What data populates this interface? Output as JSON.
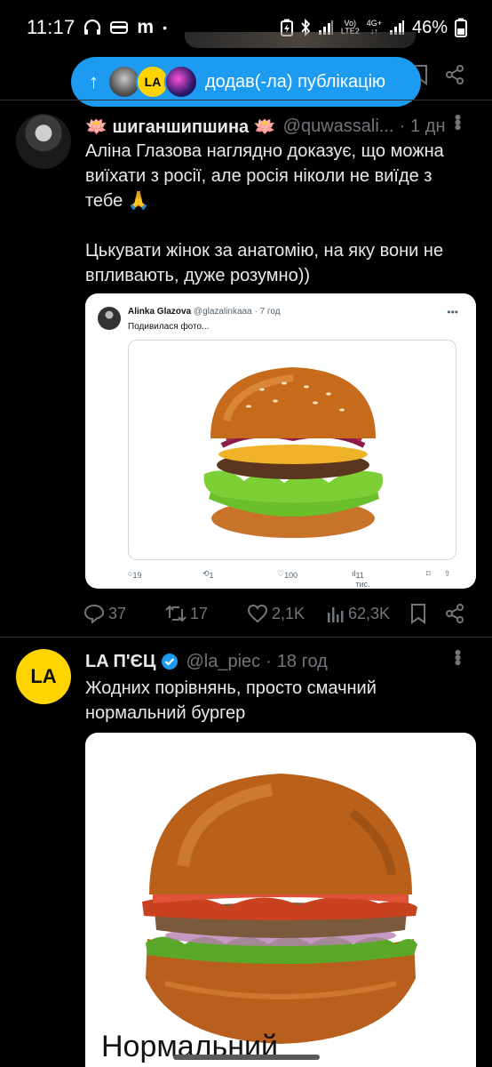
{
  "status_bar": {
    "time": "11:17",
    "carrier_glyph": "m",
    "dot": "•",
    "network_top": "Vo)",
    "network_bottom": "LTE2",
    "network_4g": "4G+",
    "battery": "46%"
  },
  "new_posts_pill": {
    "arrow": "↑",
    "avatar_la": "LA",
    "text": "додав(-ла) публікацію"
  },
  "tweet1": {
    "display_name": "🪷 шиганшипшина 🪷",
    "handle": "@quwassali...",
    "dot": "·",
    "time": "1 дн",
    "text": "Аліна Глазова наглядно доказує, що можна виїхати з росії, але росія ніколи не виїде з тебе 🙏\n\nЦькувати жінок за анатомію, на яку вони не впливають, дуже розумно))",
    "quote": {
      "display_name": "Alinka Glazova",
      "handle": "@glazalinkaaa",
      "dot": "·",
      "time": "7 год",
      "text": "Подивилася фото...",
      "replies": "19",
      "reposts": "1",
      "likes": "100",
      "views": "11 тис."
    },
    "replies": "37",
    "reposts": "17",
    "likes": "2,1K",
    "views": "62,3K"
  },
  "tweet2": {
    "avatar_text": "LA",
    "display_name": "LA П'ЄЦ",
    "handle": "@la_piec",
    "dot": "·",
    "time": "18 год",
    "text": "Жодних порівнянь, просто смачний нормальний бургер",
    "image_caption_partial": "Нормальний"
  },
  "colors": {
    "accent": "#1d9bf0",
    "verified": "#1d9bf0",
    "muted": "#71767b",
    "divider": "#2f3336",
    "la_avatar": "#ffd400"
  },
  "icons": [
    "headphones-icon",
    "card-icon",
    "reply-icon",
    "repost-icon",
    "like-icon",
    "views-icon",
    "bookmark-icon",
    "share-icon",
    "more-icon",
    "verified-icon",
    "arrow-up-icon"
  ]
}
